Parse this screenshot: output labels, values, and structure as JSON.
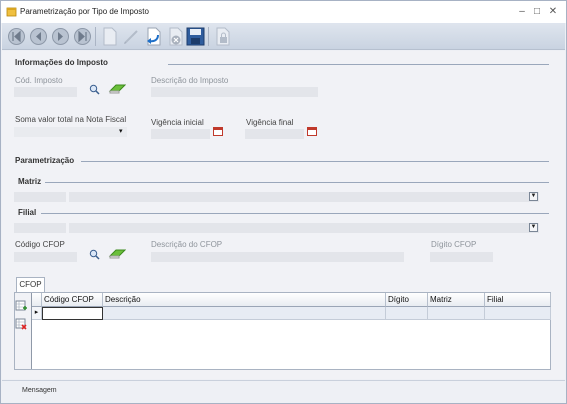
{
  "window": {
    "title": "Parametrização por Tipo de Imposto",
    "minimize_label": "–",
    "maximize_label": "□",
    "close_label": "✕"
  },
  "toolbar": {
    "buttons": [
      "first-icon",
      "previous-icon",
      "next-icon",
      "last-icon",
      "new-icon",
      "edit-icon",
      "undo-icon",
      "cancel-icon",
      "save-icon",
      "lock-icon"
    ]
  },
  "info": {
    "section_title": "Informações do Imposto",
    "cod_imposto_label": "Cód. Imposto",
    "descricao_imposto_label": "Descrição do Imposto",
    "soma_label": "Soma valor total na Nota Fiscal",
    "vigencia_inicial_label": "Vigência inicial",
    "vigencia_final_label": "Vigência final"
  },
  "param": {
    "section_title": "Parametrização",
    "matriz_title": "Matriz",
    "filial_title": "Filial",
    "codigo_cfop_label": "Código CFOP",
    "descricao_cfop_label": "Descrição do CFOP",
    "digito_cfop_label": "Dígito CFOP"
  },
  "tabs": {
    "cfop": "CFOP"
  },
  "grid": {
    "columns": [
      "Código CFOP",
      "Descrição",
      "Dígito",
      "Matriz",
      "Filial"
    ],
    "row_indicator": "▸"
  },
  "status": {
    "message_label": "Mensagem"
  }
}
